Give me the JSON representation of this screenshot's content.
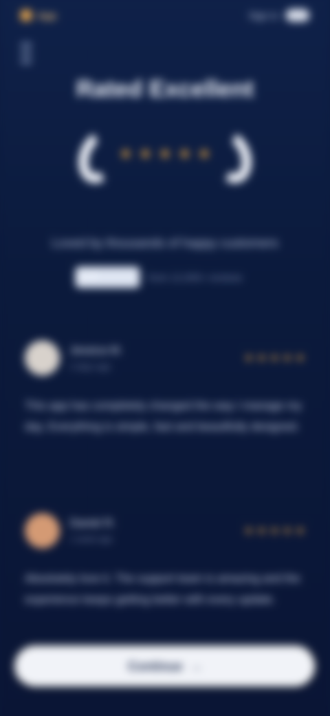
{
  "app": {
    "brand_name": "App",
    "status_text": "Sign in"
  },
  "hero": {
    "title": "Rated Excellent",
    "subtitle": "Loved by thousands of happy customers",
    "score": "4.8",
    "count_text": "from 12,000+ reviews",
    "stars": [
      "★",
      "★",
      "★",
      "★",
      "★"
    ]
  },
  "reviews": [
    {
      "name": "Jessica M.",
      "date": "2 days ago",
      "stars": [
        "★",
        "★",
        "★",
        "★",
        "★"
      ],
      "text": "This app has completely changed the way I manage my day. Everything is simple, fast and beautifully designed.",
      "avatar_color": "#d8d2cc"
    },
    {
      "name": "Daniel R.",
      "date": "1 week ago",
      "stars": [
        "★",
        "★",
        "★",
        "★",
        "★"
      ],
      "text": "Absolutely love it. The support team is amazing and the experience keeps getting better with every update.",
      "avatar_color": "#d49a74"
    }
  ],
  "cta": {
    "label": "Continue",
    "arrow": "→"
  },
  "colors": {
    "background": "#0c1a3d",
    "accent": "#e6a23c",
    "cta_bg": "#f1f3f8"
  }
}
